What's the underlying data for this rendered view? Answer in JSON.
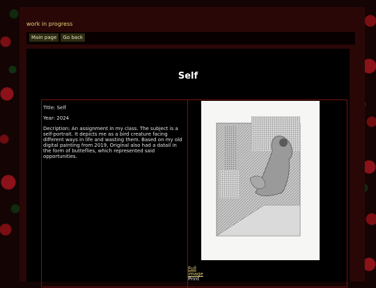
{
  "site": {
    "title": "work in progress"
  },
  "nav": {
    "items": [
      {
        "label": "Main page"
      },
      {
        "label": "Go back"
      }
    ]
  },
  "page": {
    "heading": "Self",
    "title_line": "Title: Self",
    "year_line": "Year: 2024",
    "description_line": "Decription: An assignment in my class. The subject is a self-portrait. It depicts me as a bird creature facing different ways in life and wasting them. Based on my old digital painting from 2019, Original also had a datail in the form of butteflies, which represented said opportunities.",
    "image_alt": "Pencil drawing of a bird creature",
    "full_image_link": "Full image",
    "print_label": "Print"
  },
  "colors": {
    "link": "#e8d37a",
    "border": "#7a1212",
    "panel": "#000000"
  }
}
